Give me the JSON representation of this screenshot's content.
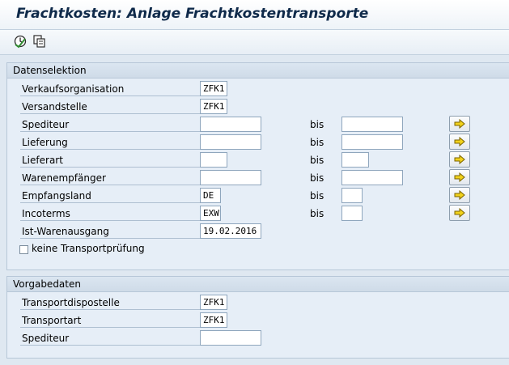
{
  "window": {
    "title": "Frachtkosten: Anlage Frachtkostentransporte"
  },
  "toolbar": {
    "icons": [
      "execute-icon",
      "variant-icon"
    ]
  },
  "datenselektion": {
    "header": "Datenselektion",
    "rows": [
      {
        "label": "Verkaufsorganisation",
        "from": "ZFK1"
      },
      {
        "label": "Versandstelle",
        "from": "ZFK1"
      },
      {
        "label": "Spediteur",
        "from": "",
        "bis": "bis",
        "to": ""
      },
      {
        "label": "Lieferung",
        "from": "",
        "bis": "bis",
        "to": ""
      },
      {
        "label": "Lieferart",
        "from": "",
        "bis": "bis",
        "to": ""
      },
      {
        "label": "Warenempfänger",
        "from": "",
        "bis": "bis",
        "to": ""
      },
      {
        "label": "Empfangsland",
        "from": "DE",
        "bis": "bis",
        "to": ""
      },
      {
        "label": "Incoterms",
        "from": "EXW",
        "bis": "bis",
        "to": ""
      },
      {
        "label": "Ist-Warenausgang",
        "from": "19.02.2016"
      }
    ],
    "checkbox_label": "keine Transportprüfung",
    "checkbox_checked": false
  },
  "vorgabedaten": {
    "header": "Vorgabedaten",
    "rows": [
      {
        "label": "Transportdispostelle",
        "value": "ZFK1"
      },
      {
        "label": "Transportart",
        "value": "ZFK1"
      },
      {
        "label": "Spediteur",
        "value": ""
      }
    ]
  },
  "colors": {
    "background": "#dfe8f1",
    "title": "#0f2a4a",
    "arrow": "#f2d21b"
  }
}
